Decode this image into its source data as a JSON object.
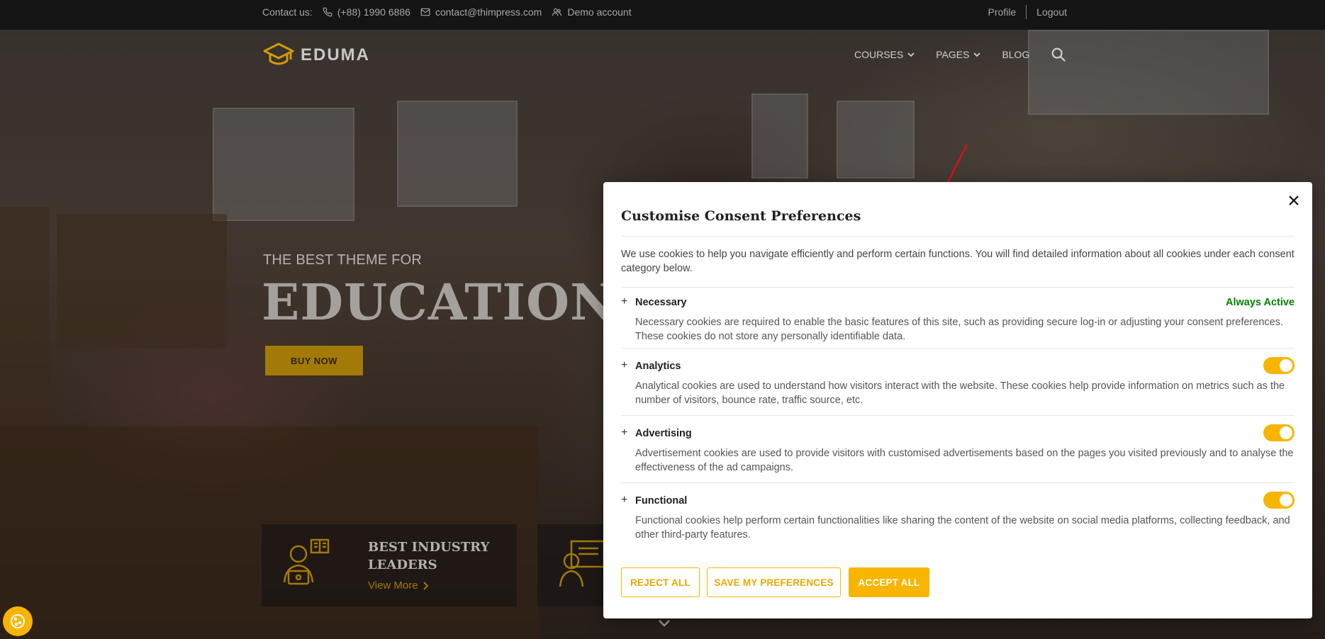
{
  "topbar": {
    "contact_label": "Contact us:",
    "phone": "(+88) 1990 6886",
    "email": "contact@thimpress.com",
    "demo": "Demo account",
    "profile": "Profile",
    "logout": "Logout"
  },
  "header": {
    "logo_text": "EDUMA",
    "nav": [
      {
        "label": "COURSES",
        "icon": "chevron-down-icon"
      },
      {
        "label": "PAGES",
        "icon": "chevron-down-icon"
      },
      {
        "label": "BLOG"
      }
    ],
    "search_icon": "search-icon"
  },
  "hero": {
    "subtitle": "THE BEST THEME FOR",
    "title": "EDUCATION",
    "cta": "BUY NOW"
  },
  "features": [
    {
      "title": "BEST INDUSTRY LEADERS",
      "link": "View More"
    }
  ],
  "modal": {
    "title": "Customise Consent Preferences",
    "intro": "We use cookies to help you navigate efficiently and perform certain functions. You will find detailed information about all cookies under each consent category below.",
    "categories": [
      {
        "name": "Necessary",
        "status": "Always Active",
        "description": "Necessary cookies are required to enable the basic features of this site, such as providing secure log-in or adjusting your consent preferences. These cookies do not store any personally identifiable data."
      },
      {
        "name": "Analytics",
        "enabled": true,
        "description": "Analytical cookies are used to understand how visitors interact with the website. These cookies help provide information on metrics such as the number of visitors, bounce rate, traffic source, etc."
      },
      {
        "name": "Advertising",
        "enabled": true,
        "description": "Advertisement cookies are used to provide visitors with customised advertisements based on the pages you visited previously and to analyse the effectiveness of the ad campaigns."
      },
      {
        "name": "Functional",
        "enabled": true,
        "description": "Functional cookies help perform certain functionalities like sharing the content of the website on social media platforms, collecting feedback, and other third-party features."
      }
    ],
    "buttons": {
      "reject": "REJECT ALL",
      "save": "SAVE MY PREFERENCES",
      "accept": "ACCEPT ALL"
    }
  },
  "colors": {
    "accent": "#f7b500",
    "active_green": "#008000",
    "topbar_bg": "#141414"
  }
}
